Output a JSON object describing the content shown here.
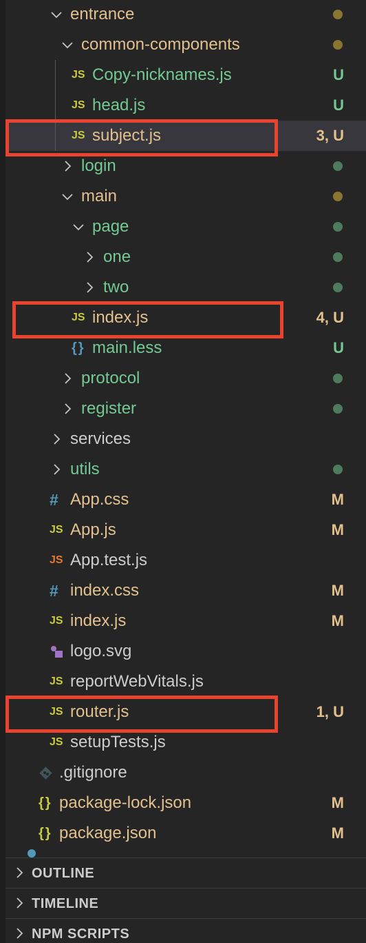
{
  "explorer": {
    "tree": [
      {
        "label": "entrance",
        "kind": "folder",
        "expanded": true,
        "depth": 2,
        "color": "yellow",
        "decoration": "",
        "dot": "yellow"
      },
      {
        "label": "common-components",
        "kind": "folder",
        "expanded": true,
        "depth": 3,
        "color": "yellow",
        "decoration": "",
        "dot": "yellow"
      },
      {
        "label": "Copy-nicknames.js",
        "kind": "file",
        "icon": "JS",
        "iconClass": "js",
        "iconName": "javascript-file-icon",
        "depth": 4,
        "color": "green",
        "decoration": "U"
      },
      {
        "label": "head.js",
        "kind": "file",
        "icon": "JS",
        "iconClass": "js",
        "iconName": "javascript-file-icon",
        "depth": 4,
        "color": "green",
        "decoration": "U"
      },
      {
        "label": "subject.js",
        "kind": "file",
        "icon": "JS",
        "iconClass": "js",
        "iconName": "javascript-file-icon",
        "depth": 4,
        "color": "yellow",
        "decoration": "3, U",
        "selected": true
      },
      {
        "label": "login",
        "kind": "folder",
        "expanded": false,
        "depth": 3,
        "color": "green",
        "decoration": "",
        "dot": "green"
      },
      {
        "label": "main",
        "kind": "folder",
        "expanded": true,
        "depth": 3,
        "color": "yellow",
        "decoration": "",
        "dot": "yellow"
      },
      {
        "label": "page",
        "kind": "folder",
        "expanded": true,
        "depth": 4,
        "color": "green",
        "decoration": "",
        "dot": "green"
      },
      {
        "label": "one",
        "kind": "folder",
        "expanded": false,
        "depth": 5,
        "color": "green",
        "decoration": "",
        "dot": "green"
      },
      {
        "label": "two",
        "kind": "folder",
        "expanded": false,
        "depth": 5,
        "color": "green",
        "decoration": "",
        "dot": "green"
      },
      {
        "label": "index.js",
        "kind": "file",
        "icon": "JS",
        "iconClass": "js",
        "iconName": "javascript-file-icon",
        "depth": 4,
        "color": "yellow",
        "decoration": "4, U"
      },
      {
        "label": "main.less",
        "kind": "file",
        "icon": "{}",
        "iconClass": "brace-blue",
        "iconName": "less-file-icon",
        "depth": 4,
        "color": "green",
        "decoration": "U"
      },
      {
        "label": "protocol",
        "kind": "folder",
        "expanded": false,
        "depth": 3,
        "color": "green",
        "decoration": "",
        "dot": "green"
      },
      {
        "label": "register",
        "kind": "folder",
        "expanded": false,
        "depth": 3,
        "color": "green",
        "decoration": "",
        "dot": "green"
      },
      {
        "label": "services",
        "kind": "folder",
        "expanded": false,
        "depth": 2,
        "color": "default",
        "decoration": ""
      },
      {
        "label": "utils",
        "kind": "folder",
        "expanded": false,
        "depth": 2,
        "color": "green",
        "decoration": "",
        "dot": "green"
      },
      {
        "label": "App.css",
        "kind": "file",
        "icon": "#",
        "iconClass": "hash",
        "iconName": "css-file-icon",
        "depth": 2,
        "color": "yellow",
        "decoration": "M"
      },
      {
        "label": "App.js",
        "kind": "file",
        "icon": "JS",
        "iconClass": "js",
        "iconName": "javascript-file-icon",
        "depth": 2,
        "color": "yellow",
        "decoration": "M"
      },
      {
        "label": "App.test.js",
        "kind": "file",
        "icon": "JS",
        "iconClass": "jstest",
        "iconName": "test-file-icon",
        "depth": 2,
        "color": "default",
        "decoration": ""
      },
      {
        "label": "index.css",
        "kind": "file",
        "icon": "#",
        "iconClass": "hash",
        "iconName": "css-file-icon",
        "depth": 2,
        "color": "yellow",
        "decoration": "M"
      },
      {
        "label": "index.js",
        "kind": "file",
        "icon": "JS",
        "iconClass": "js",
        "iconName": "javascript-file-icon",
        "depth": 2,
        "color": "yellow",
        "decoration": "M"
      },
      {
        "label": "logo.svg",
        "kind": "file",
        "icon": "svg",
        "iconClass": "svgicon",
        "iconName": "svg-file-icon",
        "depth": 2,
        "color": "default",
        "decoration": ""
      },
      {
        "label": "reportWebVitals.js",
        "kind": "file",
        "icon": "JS",
        "iconClass": "js",
        "iconName": "javascript-file-icon",
        "depth": 2,
        "color": "default",
        "decoration": ""
      },
      {
        "label": "router.js",
        "kind": "file",
        "icon": "JS",
        "iconClass": "js",
        "iconName": "javascript-file-icon",
        "depth": 2,
        "color": "yellow",
        "decoration": "1, U"
      },
      {
        "label": "setupTests.js",
        "kind": "file",
        "icon": "JS",
        "iconClass": "js",
        "iconName": "javascript-file-icon",
        "depth": 2,
        "color": "default",
        "decoration": ""
      },
      {
        "label": ".gitignore",
        "kind": "file",
        "icon": "git",
        "iconClass": "giticon",
        "iconName": "git-file-icon",
        "depth": 1,
        "color": "default",
        "decoration": ""
      },
      {
        "label": "package-lock.json",
        "kind": "file",
        "icon": "{}",
        "iconClass": "brace",
        "iconName": "json-file-icon",
        "depth": 1,
        "color": "yellow",
        "decoration": "M"
      },
      {
        "label": "package.json",
        "kind": "file",
        "icon": "{}",
        "iconClass": "brace",
        "iconName": "json-file-icon",
        "depth": 1,
        "color": "yellow",
        "decoration": "M"
      }
    ],
    "highlights": [
      "subject.js",
      "index.js",
      "router.js"
    ],
    "sections": [
      {
        "title": "OUTLINE"
      },
      {
        "title": "TIMELINE"
      },
      {
        "title": "NPM SCRIPTS"
      }
    ]
  },
  "colors": {
    "background": "#252526",
    "untracked_green": "#73c991",
    "modified_yellow": "#e2c08d",
    "default_text": "#cccccc",
    "js_icon": "#cbcb41",
    "css_icon": "#519aba",
    "highlight_box": "#e8432e"
  }
}
